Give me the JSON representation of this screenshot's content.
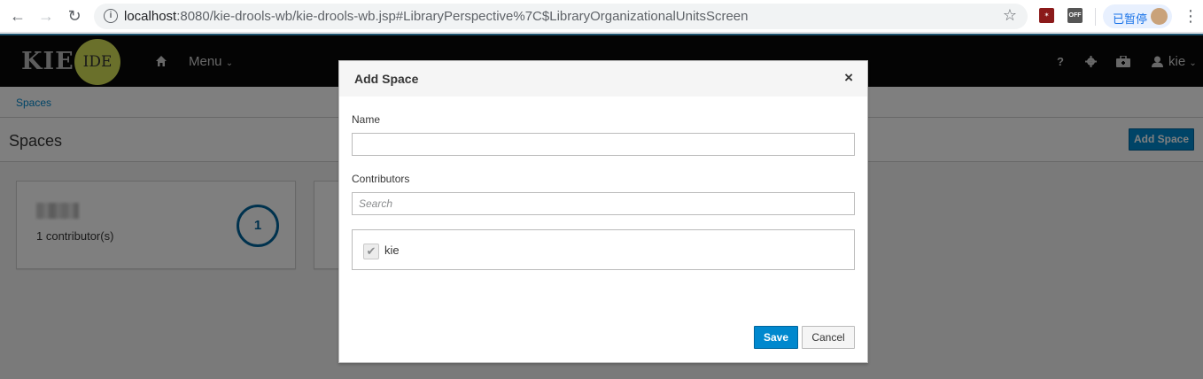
{
  "browser": {
    "url_host": "localhost",
    "url_rest": ":8080/kie-drools-wb/kie-drools-wb.jsp#LibraryPerspective%7C$LibraryOrganizationalUnitsScreen",
    "ext_off_label": "OFF",
    "profile_label": "已暂停"
  },
  "app": {
    "logo_text": "KIE",
    "logo_badge": "IDE",
    "menu_label": "Menu",
    "help_label": "?",
    "user_name": "kie"
  },
  "page": {
    "breadcrumb": "Spaces",
    "title": "Spaces",
    "add_space_label": "Add Space",
    "cards": [
      {
        "contributors": "1 contributor(s)",
        "count": "1"
      }
    ]
  },
  "modal": {
    "title": "Add Space",
    "close_glyph": "×",
    "name_label": "Name",
    "name_value": "",
    "contributors_label": "Contributors",
    "search_placeholder": "Search",
    "contributors": [
      {
        "name": "kie",
        "checked": true
      }
    ],
    "save_label": "Save",
    "cancel_label": "Cancel"
  },
  "colors": {
    "accent": "#0088ce",
    "topbar": "#080808",
    "logo_badge": "#d4e157"
  }
}
